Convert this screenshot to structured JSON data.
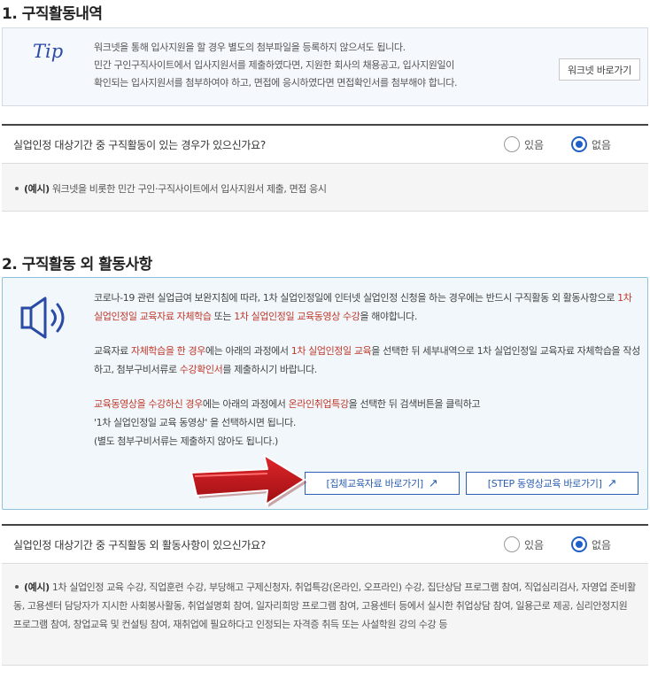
{
  "section1": {
    "title": "1. 구직활동내역",
    "tip": {
      "label": "Tip",
      "lines": [
        "워크넷을 통해 입사지원을 할 경우 별도의 첨부파일을 등록하지 않으셔도 됩니다.",
        "민간 구인구직사이트에서 입사지원서를 제출하였다면, 지원한 회사의 채용공고, 입사지원일이",
        "확인되는 입사지원서를 첨부하여야 하고, 면접에 응시하였다면 면접확인서를 첨부해야 합니다."
      ],
      "button_label": "워크넷 바로가기"
    },
    "question": {
      "text": "실업인정 대상기간 중 구직활동이 있는 경우가 있으신가요?",
      "options": [
        "있음",
        "없음"
      ],
      "selected": "없음"
    },
    "example": {
      "label": "(예시)",
      "text": "워크넷을 비롯한 민간 구인·구직사이트에서 입사지원서 제출, 면접 응시"
    }
  },
  "section2": {
    "title": "2. 구직활동 외 활동사항",
    "notice": {
      "p1_a": "코로나-19 관련 실업급여 보완지침에 따라, 1차 실업인정일에 인터넷 실업인정 신청을 하는 경우에는 반드시 구직활동 외 활동사항으로 ",
      "p1_b": "1차 실업인정일 교육자료 자체학습",
      "p1_c": " 또는 ",
      "p1_d": "1차 실업인정일 교육동영상 수강",
      "p1_e": "을 해야합니다.",
      "p2_a": "교육자료 ",
      "p2_b": "자체학습을 한 경우",
      "p2_c": "에는 아래의 과정에서 ",
      "p2_d": "1차 실업인정일 교육",
      "p2_e": "을 선택한 뒤 세부내역으로 1차 실업인정일 교육자료 자체학습을 작성하고, 첨부구비서류로 ",
      "p2_f": "수강확인서",
      "p2_g": "를 제출하시기 바랍니다.",
      "p3_a": "교육동영상을 수강하신 경우",
      "p3_b": "에는 아래의 과정에서 ",
      "p3_c": "온라인취업특강",
      "p3_d": "을 선택한 뒤 검색버튼을 클릭하고",
      "p3_line2": "'1차 실업인정일 교육 동영상' 을 선택하시면 됩니다.",
      "p3_line3": "(별도 첨부구비서류는 제출하지 않아도 됩니다.)",
      "button1_label": "[집체교육자료 바로가기]",
      "button2_label": "[STEP 동영상교육 바로가기]",
      "external_glyph": "↗"
    },
    "question": {
      "text": "실업인정 대상기간 중 구직활동 외 활동사항이 있으신가요?",
      "options": [
        "있음",
        "없음"
      ],
      "selected": "없음"
    },
    "example": {
      "label": "(예시)",
      "text": "1차 실업인정 교육 수강, 직업훈련 수강, 부당해고 구제신청자, 취업특강(온라인, 오프라인) 수강, 집단상담 프로그램 참여, 직업심리검사, 자영업 준비활동, 고용센터 담당자가 지시한 사회봉사활동, 취업설명회 참여, 일자리희망 프로그램 참여, 고용센터 등에서 실시한 취업상담 참여, 일용근로 제공, 심리안정지원 프로그램 참여, 창업교육 및 컨설팅 참여, 재취업에 필요하다고 인정되는 자격증 취득 또는 사설학원 강의 수강 등"
    }
  },
  "colors": {
    "accent_blue": "#1f60c8",
    "highlight_red": "#c0392b",
    "arrow_red": "#c0151a",
    "notice_border": "#8fc1dd"
  },
  "icons": [
    "speaker-icon",
    "external-link-icon",
    "red-arrow-pointer"
  ]
}
